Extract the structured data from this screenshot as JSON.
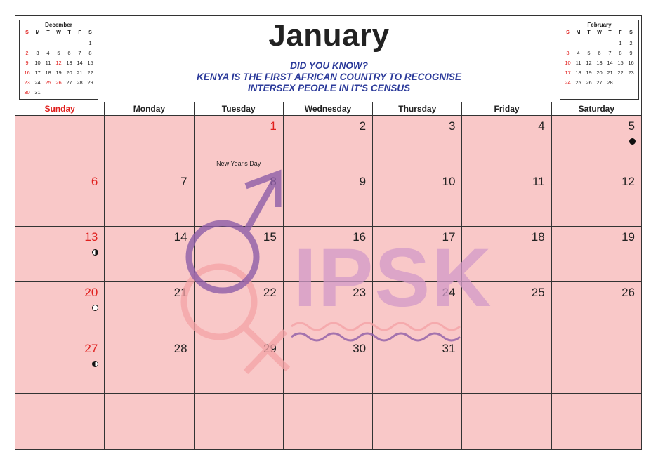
{
  "header": {
    "month": "January",
    "fact_lines": [
      "DID YOU KNOW?",
      "KENYA IS THE FIRST AFRICAN COUNTRY TO RECOGNISE",
      "INTERSEX PEOPLE IN IT'S CENSUS"
    ]
  },
  "mini_prev": {
    "title": "December",
    "dow": [
      "S",
      "M",
      "T",
      "W",
      "T",
      "F",
      "S"
    ],
    "days": [
      "",
      "",
      "",
      "",
      "",
      "",
      "1",
      "2",
      "3",
      "4",
      "5",
      "6",
      "7",
      "8",
      "9",
      "10",
      "11",
      "12",
      "13",
      "14",
      "15",
      "16",
      "17",
      "18",
      "19",
      "20",
      "21",
      "22",
      "23",
      "24",
      "25",
      "26",
      "27",
      "28",
      "29",
      "30",
      "31",
      "",
      "",
      "",
      "",
      ""
    ]
  },
  "mini_next": {
    "title": "February",
    "dow": [
      "S",
      "M",
      "T",
      "W",
      "T",
      "F",
      "S"
    ],
    "days": [
      "",
      "",
      "",
      "",
      "",
      "1",
      "2",
      "3",
      "4",
      "5",
      "6",
      "7",
      "8",
      "9",
      "10",
      "11",
      "12",
      "13",
      "14",
      "15",
      "16",
      "17",
      "18",
      "19",
      "20",
      "21",
      "22",
      "23",
      "24",
      "25",
      "26",
      "27",
      "28",
      "",
      "",
      "",
      "",
      "",
      "",
      ""
    ]
  },
  "weekdays": [
    "Sunday",
    "Monday",
    "Tuesday",
    "Wednesday",
    "Thursday",
    "Friday",
    "Saturday"
  ],
  "cells": [
    "",
    "",
    "1",
    "2",
    "3",
    "4",
    "5",
    "6",
    "7",
    "8",
    "9",
    "10",
    "11",
    "12",
    "13",
    "14",
    "15",
    "16",
    "17",
    "18",
    "19",
    "20",
    "21",
    "22",
    "23",
    "24",
    "25",
    "26",
    "27",
    "28",
    "29",
    "30",
    "31",
    "",
    "",
    "",
    "",
    "",
    "",
    "",
    "",
    ""
  ],
  "holiday": {
    "day": "1",
    "label": "New Year's Day"
  },
  "moon_phases": [
    {
      "day": "5",
      "phase": "new-moon"
    },
    {
      "day": "13",
      "phase": "first-quarter"
    },
    {
      "day": "20",
      "phase": "full-moon"
    },
    {
      "day": "27",
      "phase": "last-quarter"
    }
  ],
  "watermark": {
    "text": "IPSK"
  },
  "colors": {
    "cell_bg": "#f9c8c8",
    "sunday_red": "#e0201e",
    "fact_blue": "#2b3a9a",
    "male_symbol": "#8e5ea8",
    "female_symbol": "#f4a3a6"
  }
}
